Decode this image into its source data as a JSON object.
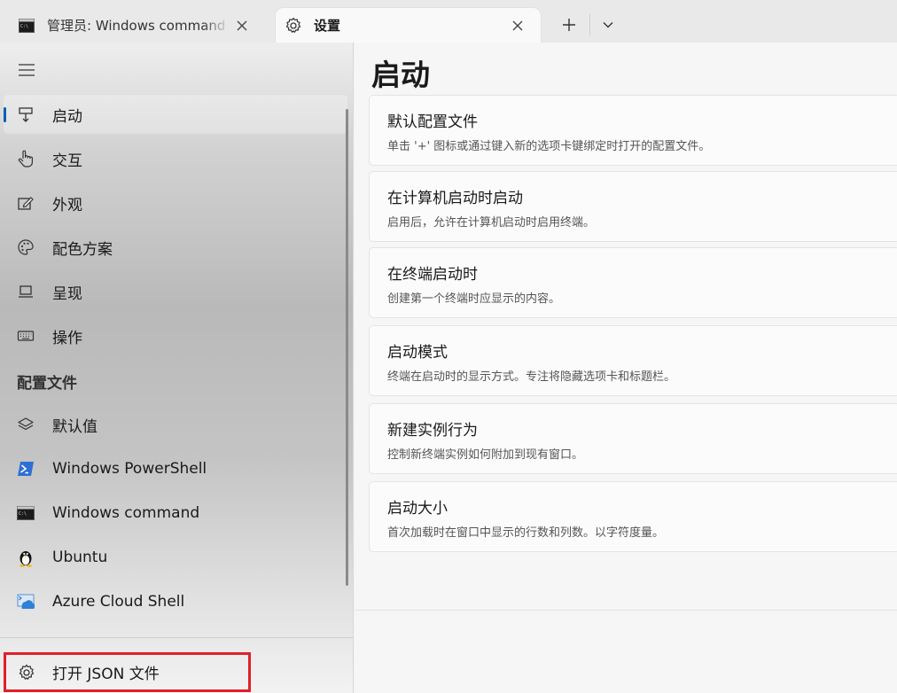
{
  "tabs": [
    {
      "title": "管理员: Windows command - g",
      "icon": "cmd-icon",
      "active": false
    },
    {
      "title": "设置",
      "icon": "gear-icon",
      "active": true
    }
  ],
  "sidebar": {
    "items": [
      {
        "label": "启动",
        "icon": "launch-icon",
        "selected": true
      },
      {
        "label": "交互",
        "icon": "hand-pointer-icon"
      },
      {
        "label": "外观",
        "icon": "edit-appearance-icon"
      },
      {
        "label": "配色方案",
        "icon": "palette-icon"
      },
      {
        "label": "呈现",
        "icon": "monitor-icon"
      },
      {
        "label": "操作",
        "icon": "keyboard-icon"
      }
    ],
    "profiles_header": "配置文件",
    "profiles": [
      {
        "label": "默认值",
        "icon": "layers-icon"
      },
      {
        "label": "Windows PowerShell",
        "icon": "powershell-icon"
      },
      {
        "label": "Windows command",
        "icon": "cmd-icon"
      },
      {
        "label": "Ubuntu",
        "icon": "linux-penguin-icon"
      },
      {
        "label": "Azure Cloud Shell",
        "icon": "azure-cloud-shell-icon"
      }
    ],
    "open_json": "打开 JSON 文件"
  },
  "main": {
    "title": "启动",
    "cards": [
      {
        "title": "默认配置文件",
        "desc": "单击 '+' 图标或通过键入新的选项卡键绑定时打开的配置文件。"
      },
      {
        "title": "在计算机启动时启动",
        "desc": "启用后，允许在计算机启动时启用终端。"
      },
      {
        "title": "在终端启动时",
        "desc": "创建第一个终端时应显示的内容。"
      },
      {
        "title": "启动模式",
        "desc": "终端在启动时的显示方式。专注将隐藏选项卡和标题栏。"
      },
      {
        "title": "新建实例行为",
        "desc": "控制新终端实例如何附加到现有窗口。"
      },
      {
        "title": "启动大小",
        "desc": "首次加载时在窗口中显示的行数和列数。以字符度量。"
      }
    ]
  },
  "colors": {
    "accent": "#005fb8",
    "highlight_box": "#e0202a"
  }
}
